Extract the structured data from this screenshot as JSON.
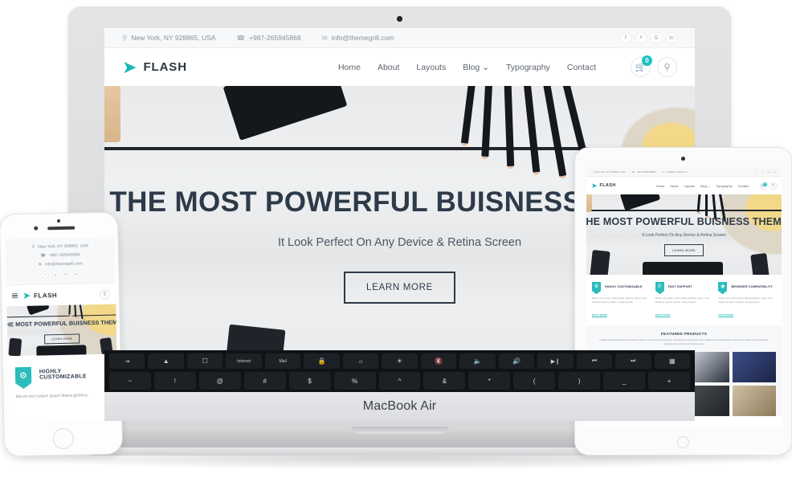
{
  "site": {
    "topbar": {
      "address": "New York, NY 928865, USA",
      "phone": "+987-265945868",
      "email": "info@themegrill.com",
      "social": [
        "f",
        "𝕥",
        "G+",
        "in"
      ]
    },
    "brand": {
      "name": "FLASH",
      "mark": "➤",
      "accent": "#1ec0c0",
      "dark": "#2d3a49"
    },
    "nav": [
      {
        "label": "Home",
        "has_dropdown": false
      },
      {
        "label": "About",
        "has_dropdown": false
      },
      {
        "label": "Layouts",
        "has_dropdown": false
      },
      {
        "label": "Blog",
        "has_dropdown": true
      },
      {
        "label": "Typography",
        "has_dropdown": false
      },
      {
        "label": "Contact",
        "has_dropdown": false
      }
    ],
    "cart_count": "0",
    "hero": {
      "headline": "THE MOST POWERFUL BUISNESS THEME",
      "subheadline": "It Look Perfect On Any Device & Retina Screen",
      "cta": "LEARN MORE"
    },
    "features": [
      {
        "title": "HIGHLY CUSTOMIZABLE",
        "icon": "gear-icon",
        "body": "Mirum est notare quam littera gothica, quam nunc putamus parum claram, anteposuerit",
        "link": "READ MORE"
      },
      {
        "title": "FAST SUPPORT",
        "icon": "headset-icon",
        "body": "Mirum est notare quam littera gothica, quam nunc putamus parum claram, anteposuerit",
        "link": "READ MORE"
      },
      {
        "title": "BROWSER COMPATIBILITY",
        "icon": "globe-icon",
        "body": "Mirum est notare quam littera gothica, quam nunc putamus parum claram, anteposuerit",
        "link": "READ MORE"
      }
    ],
    "products": {
      "title": "FEATURED PRODUCTS",
      "description": "Collaboratively administrate empowered markets via plug-and-play networks. Dynamically procrastinate users Collaboratively administrate empowered markets via plug-and-play networks. Dynamically procrastinate users.",
      "grid_colors": [
        "#6b563f",
        "#cbb896",
        "#3b4452",
        "#2b3a6b",
        "#4a4f58",
        "#7a6a55",
        "#2f3338",
        "#b9a68a"
      ]
    },
    "phone_feature": {
      "title": "HIGHLY CUSTOMIZABLE",
      "body": "Mirum est notare quam littera gothica,"
    }
  },
  "devices": {
    "laptop_label": "MacBook Air",
    "fn_keys": [
      "⎋",
      "⌂",
      "❐",
      "Internet",
      "Mail",
      "🔒",
      "☀-",
      "☀+",
      "🔇",
      "🔉",
      "🔊",
      "▶❘❘",
      "⏮",
      "⏭",
      "▒"
    ],
    "num_keys": [
      "~",
      "!",
      "@",
      "#",
      "$",
      "%",
      "^",
      "&",
      "*",
      "(",
      ")",
      "_",
      "+"
    ]
  }
}
